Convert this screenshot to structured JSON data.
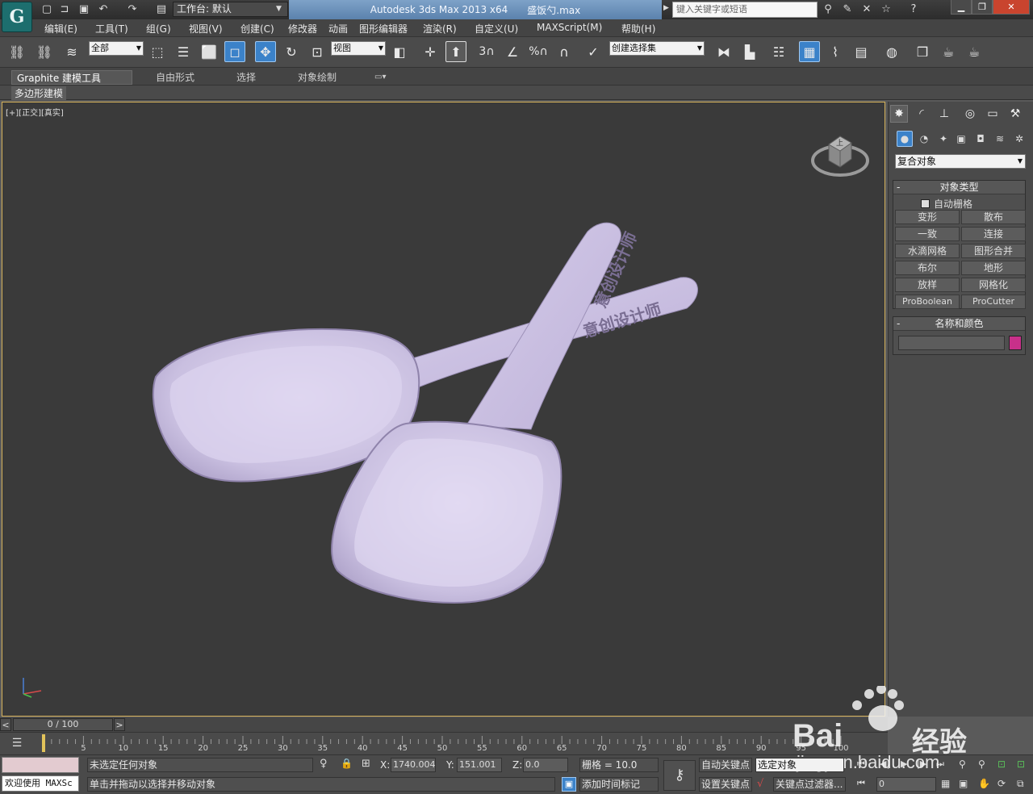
{
  "titlebar": {
    "workspace_label": "工作台: 默认",
    "app_name": "Autodesk 3ds Max  2013 x64",
    "file_name": "盛饭勺.max",
    "search_placeholder": "键入关键字或短语"
  },
  "menu": [
    "编辑(E)",
    "工具(T)",
    "组(G)",
    "视图(V)",
    "创建(C)",
    "修改器",
    "动画",
    "图形编辑器",
    "渲染(R)",
    "自定义(U)",
    "MAXScript(M)",
    "帮助(H)"
  ],
  "toolbar": {
    "selection_filter": "全部",
    "ref_coord": "视图",
    "named_selection": "创建选择集",
    "snap_3": "3",
    "percent": "%"
  },
  "ribbon": {
    "tabs": [
      "Graphite 建模工具",
      "自由形式",
      "选择",
      "对象绘制"
    ],
    "subpanel": "多边形建模"
  },
  "viewport": {
    "label": "[+][正交][真实]",
    "spoon_text": "意创设计师",
    "cube_label": "上"
  },
  "command_panel": {
    "category": "复合对象",
    "object_type_title": "对象类型",
    "autogrid_label": "自动栅格",
    "buttons": [
      "变形",
      "散布",
      "一致",
      "连接",
      "水滴网格",
      "图形合并",
      "布尔",
      "地形",
      "放样",
      "网格化",
      "ProBoolean",
      "ProCutter"
    ],
    "name_color_title": "名称和颜色",
    "object_color": "#c8308a"
  },
  "timeline": {
    "frame_display": "0 / 100",
    "ticks": [
      "5",
      "10",
      "15",
      "20",
      "25",
      "30",
      "35",
      "40",
      "45",
      "50",
      "55",
      "60",
      "65",
      "70",
      "75",
      "80",
      "85",
      "90",
      "95",
      "100"
    ]
  },
  "status": {
    "maxscript_label": "欢迎使用 MAXSc",
    "selection_status": "未选定任何对象",
    "prompt": "单击并拖动以选择并移动对象",
    "x_label": "X:",
    "x_value": "1740.004",
    "y_label": "Y:",
    "y_value": "151.001",
    "z_label": "Z:",
    "z_value": "0.0",
    "grid_label": "栅格 = 10.0",
    "add_time_tag": "添加时间标记",
    "auto_key": "自动关键点",
    "set_key": "设置关键点",
    "selected_dd": "选定对象",
    "key_filters": "关键点过滤器...",
    "current_frame": "0"
  },
  "watermark": {
    "brand": "Bai",
    "suffix": "经验",
    "url": "jingyan.baidu.com"
  }
}
